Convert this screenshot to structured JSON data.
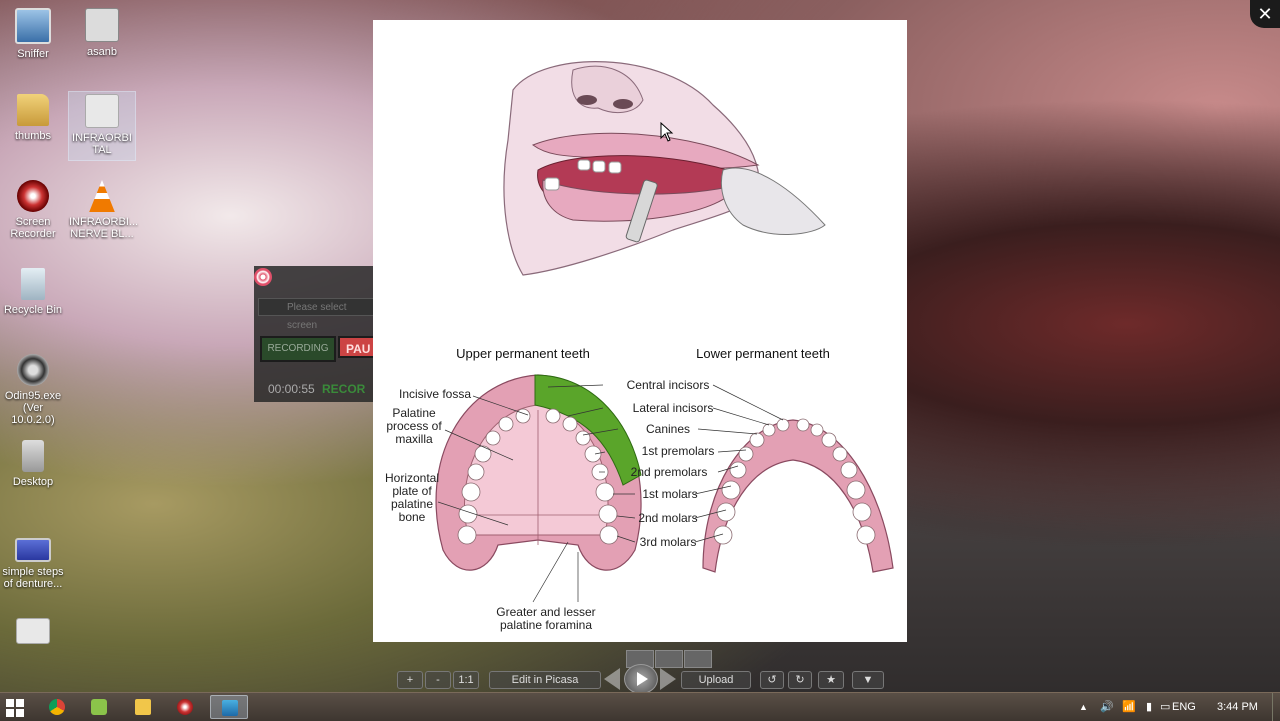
{
  "desktop": {
    "icons": [
      {
        "label": "Sniffer",
        "icon": "monitor-icon"
      },
      {
        "label": "asanb",
        "icon": "file-icon"
      },
      {
        "label": "thumbs",
        "icon": "folder-icon"
      },
      {
        "label": "INFRAORBITAL",
        "icon": "image-file-icon"
      },
      {
        "label": "Screen Recorder",
        "icon": "screen-recorder-icon"
      },
      {
        "label": "INFRAORBI... NERVE BL...",
        "icon": "vlc-cone-icon"
      },
      {
        "label": "Recycle Bin",
        "icon": "recycle-bin-icon"
      },
      {
        "label": "Odin95.exe (Ver 10.0.2.0)",
        "icon": "odin-icon"
      },
      {
        "label": "Desktop",
        "icon": "desktop-shortcut-icon"
      },
      {
        "label": "simple steps of denture...",
        "icon": "screen-file-icon"
      },
      {
        "label": "",
        "icon": "document-icon"
      }
    ]
  },
  "recorder": {
    "field": "Please select screen",
    "stop_label": "RECORDING",
    "pause_label": "PAU",
    "time": "00:00:55",
    "status": "RECOR"
  },
  "image": {
    "upper_title": "Upper permanent teeth",
    "lower_title": "Lower permanent teeth",
    "left_labels": {
      "incisive_fossa": "Incisive fossa",
      "palatine_process_1": "Palatine",
      "palatine_process_2": "process of",
      "palatine_process_3": "maxilla",
      "horizontal_1": "Horizontal",
      "horizontal_2": "plate of",
      "horizontal_3": "palatine",
      "horizontal_4": "bone",
      "foramina_1": "Greater and lesser",
      "foramina_2": "palatine foramina"
    },
    "tooth_labels": [
      "Central incisors",
      "Lateral incisors",
      "Canines",
      "1st premolars",
      "2nd premolars",
      "1st molars",
      "2nd molars",
      "3rd molars"
    ]
  },
  "viewer_toolbar": {
    "zoom_in": "+",
    "zoom_out": "-",
    "actual_size": "1:1",
    "edit_label": "Edit in Picasa",
    "upload_label": "Upload",
    "rotate_left": "↺",
    "rotate_right": "↻",
    "star": "★",
    "more": "▼",
    "close": "✕"
  },
  "taskbar": {
    "apps": [
      "chrome-icon",
      "android-icon",
      "file-explorer-icon",
      "recorder-icon",
      "picasa-icon"
    ],
    "tray_arrow": "▲",
    "language": "ENG",
    "time": "3:44 PM"
  },
  "colors": {
    "green_highlight": "#5aa52a",
    "gum_pink": "#e3a0b4",
    "palate_pink": "#f4c9d6",
    "taskbar": "#4a4038"
  }
}
